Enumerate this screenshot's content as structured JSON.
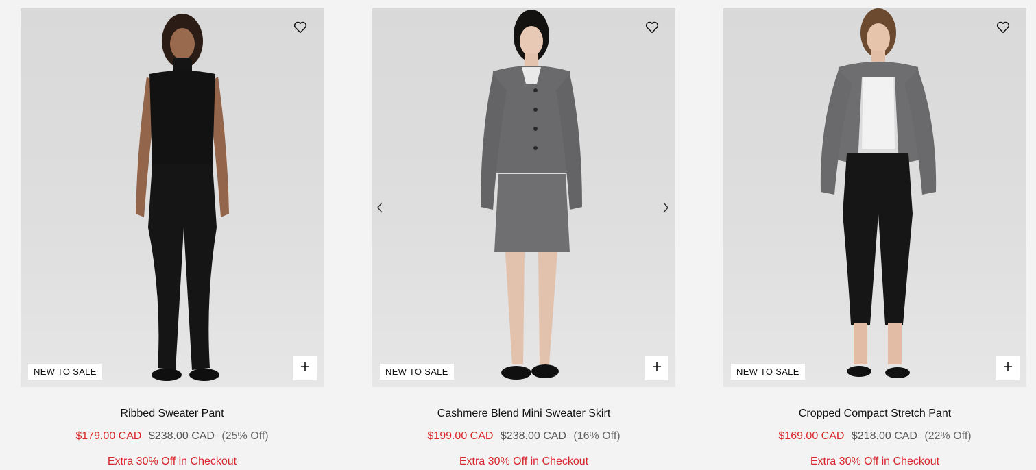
{
  "icons": {
    "wishlist": "heart-icon",
    "add": "plus-icon",
    "prev": "chevron-left-icon",
    "next": "chevron-right-icon"
  },
  "colors": {
    "sale_price": "#d8262b",
    "background": "#f3f3f3"
  },
  "products": [
    {
      "badge": "NEW TO SALE",
      "name": "Ribbed Sweater Pant",
      "sale_price": "$179.00 CAD",
      "original_price": "$238.00 CAD",
      "discount": "(25% Off)",
      "promo": "Extra 30% Off in Checkout"
    },
    {
      "badge": "NEW TO SALE",
      "name": "Cashmere Blend Mini Sweater Skirt",
      "sale_price": "$199.00 CAD",
      "original_price": "$238.00 CAD",
      "discount": "(16% Off)",
      "promo": "Extra 30% Off in Checkout"
    },
    {
      "badge": "NEW TO SALE",
      "name": "Cropped Compact Stretch Pant",
      "sale_price": "$169.00 CAD",
      "original_price": "$218.00 CAD",
      "discount": "(22% Off)",
      "promo": "Extra 30% Off in Checkout"
    }
  ]
}
